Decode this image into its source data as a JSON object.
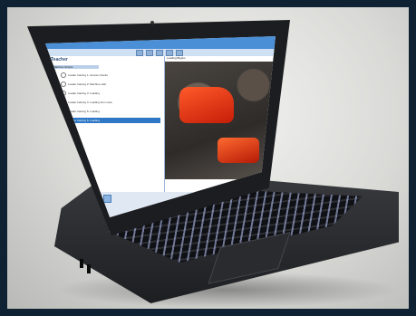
{
  "app": {
    "window_title": "",
    "panel_title": "Teacher",
    "viewer_label": "Loading Begins",
    "tree": {
      "root_label": "Machine Scripts",
      "items": [
        "Loader training 1: Access checks",
        "Loader training 2: Machine start",
        "Loader training 3: Loading",
        "Loader training 4: Loading from cave",
        "Loader training 5: Loading",
        "Loader training 6: Loading"
      ],
      "selected_index": 5
    }
  },
  "colors": {
    "titlebar": "#4b8fd6",
    "selection": "#2f78c6",
    "machine": "#e0401a"
  },
  "icons": [
    "laptop",
    "toolbar-buttons",
    "radio-bullet"
  ]
}
